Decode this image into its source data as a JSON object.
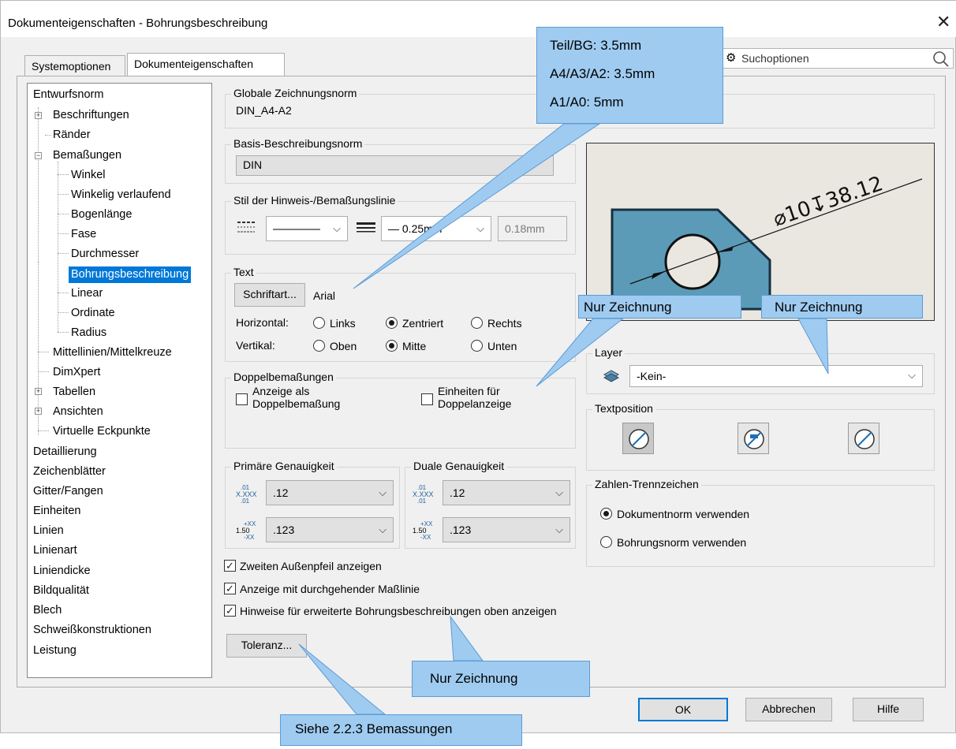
{
  "window": {
    "title": "Dokumenteigenschaften - Bohrungsbeschreibung",
    "close": "✕"
  },
  "tabs": [
    {
      "label": "Systemoptionen"
    },
    {
      "label": "Dokumenteigenschaften"
    }
  ],
  "search": {
    "placeholder": "Suchoptionen"
  },
  "tree": {
    "entwurfsnorm": "Entwurfsnorm",
    "beschriftungen": "Beschriftungen",
    "raender": "Ränder",
    "bemassungen": "Bemaßungen",
    "winkel": "Winkel",
    "winkelig": "Winkelig verlaufend",
    "bogenlaenge": "Bogenlänge",
    "fase": "Fase",
    "durchmesser": "Durchmesser",
    "bohrung": "Bohrungsbeschreibung",
    "linear": "Linear",
    "ordinate": "Ordinate",
    "radius": "Radius",
    "mittellinien": "Mittellinien/Mittelkreuze",
    "dimxpert": "DimXpert",
    "tabellen": "Tabellen",
    "ansichten": "Ansichten",
    "virtuelle": "Virtuelle Eckpunkte",
    "detaillierung": "Detaillierung",
    "zeichenblaetter": "Zeichenblätter",
    "gitter": "Gitter/Fangen",
    "einheiten": "Einheiten",
    "linien": "Linien",
    "linienart": "Linienart",
    "liniendicke": "Liniendicke",
    "bildqualitaet": "Bildqualität",
    "blech": "Blech",
    "schweiss": "Schweißkonstruktionen",
    "leistung": "Leistung"
  },
  "global_norm": {
    "title": "Globale Zeichnungsnorm",
    "value": "DIN_A4-A2"
  },
  "basis_norm": {
    "title": "Basis-Beschreibungsnorm",
    "value": "DIN"
  },
  "line_style": {
    "title": "Stil der Hinweis-/Bemaßungslinie",
    "thickness": "— 0.25mm",
    "custom": "0.18mm"
  },
  "text": {
    "title": "Text",
    "font_button": "Schriftart...",
    "font_value": "Arial",
    "horizontal_label": "Horizontal:",
    "links": "Links",
    "zentriert": "Zentriert",
    "rechts": "Rechts",
    "vertical_label": "Vertikal:",
    "oben": "Oben",
    "mitte": "Mitte",
    "unten": "Unten"
  },
  "dual": {
    "title": "Doppelbemaßungen",
    "show_dual_1": "Anzeige als",
    "show_dual_2": "Doppelbemaßung",
    "units_1": "Einheiten für",
    "units_2": "Doppelanzeige"
  },
  "precision": {
    "primary_title": "Primäre Genauigkeit",
    "dual_title": "Duale Genauigkeit",
    "primary_value": ".12",
    "primary_tol": ".123",
    "dual_value": ".12",
    "dual_tol": ".123"
  },
  "checks": {
    "second_arrow": "Zweiten Außenpfeil anzeigen",
    "solid_line": "Anzeige mit durchgehender Maßlinie",
    "hints": "Hinweise für erweiterte Bohrungsbeschreibungen oben anzeigen"
  },
  "tolerance_button": "Toleranz...",
  "preview": {
    "dim_text": "⌀10↧38.12"
  },
  "layer": {
    "title": "Layer",
    "value": "-Kein-"
  },
  "text_position": {
    "title": "Textposition"
  },
  "separator": {
    "title": "Zahlen-Trennzeichen",
    "doc_norm": "Dokumentnorm verwenden",
    "hole_norm": "Bohrungsnorm verwenden"
  },
  "buttons": {
    "ok": "OK",
    "cancel": "Abbrechen",
    "help": "Hilfe"
  },
  "callouts": {
    "font_size_1": "Teil/BG: 3.5mm",
    "font_size_2": "A4/A3/A2: 3.5mm",
    "font_size_3": "A1/A0: 5mm",
    "nur_zeichnung_1": "Nur Zeichnung",
    "nur_zeichnung_2": "Nur Zeichnung",
    "nur_zeichnung_3": "Nur Zeichnung",
    "siehe": "Siehe 2.2.3 Bemassungen"
  },
  "colors": {
    "selection": "#0078d7",
    "callout_fill": "#9fcbf0",
    "callout_border": "#5b9bd5",
    "part_fill": "#5b9bb8",
    "preview_bg": "#e9e7df"
  }
}
